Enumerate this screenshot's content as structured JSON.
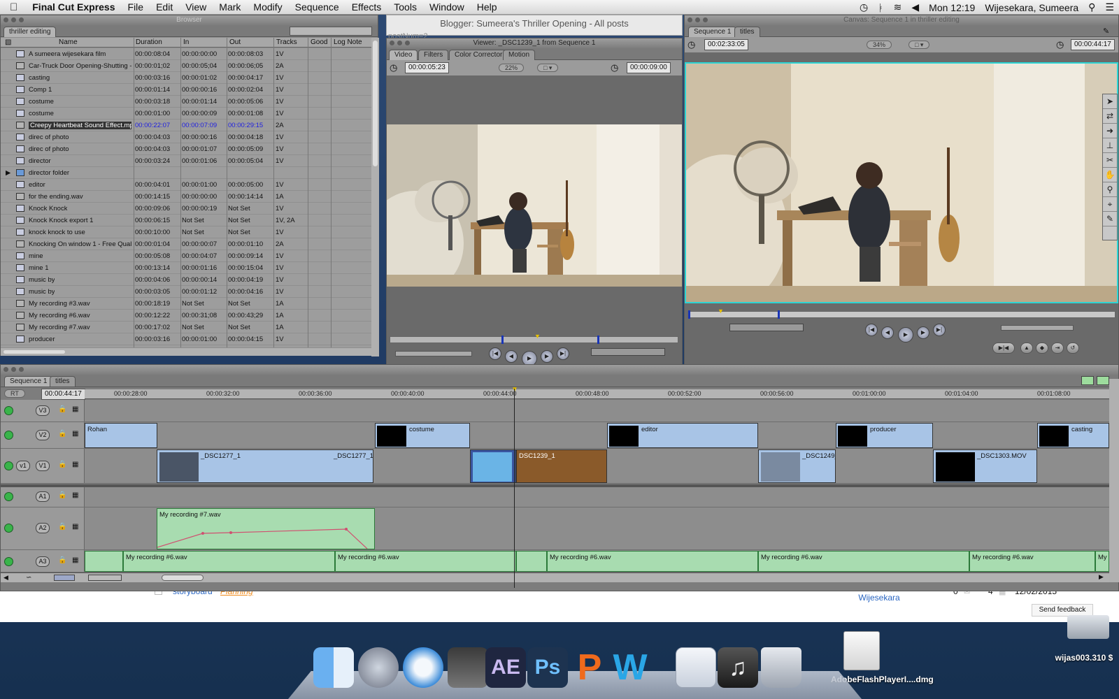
{
  "menubar": {
    "app_name": "Final Cut Express",
    "items": [
      "File",
      "Edit",
      "View",
      "Mark",
      "Modify",
      "Sequence",
      "Effects",
      "Tools",
      "Window",
      "Help"
    ],
    "clock": "Mon 12:19",
    "user": "Wijesekara, Sumeera"
  },
  "blogger_window": {
    "title": "Blogger: Sumeera's Thriller Opening - All posts",
    "url_fragment": "postNum=2"
  },
  "browser": {
    "title": "Browser",
    "tab": "thriller editing",
    "columns": [
      "Name",
      "Duration",
      "In",
      "Out",
      "Tracks",
      "Good",
      "Log Note"
    ],
    "rows": [
      {
        "name": "A sumeera wijesekara film",
        "duration": "00:00:08:04",
        "in": "00:00:00:00",
        "out": "00:00:08:03",
        "tracks": "1V",
        "kind": "seq"
      },
      {
        "name": "Car-Truck Door Opening-Shutting -",
        "duration": "00:00:01;02",
        "in": "00:00:05;04",
        "out": "00:00:06;05",
        "tracks": "2A",
        "kind": "audio"
      },
      {
        "name": "casting",
        "duration": "00:00:03:16",
        "in": "00:00:01:02",
        "out": "00:00:04:17",
        "tracks": "1V",
        "kind": "seq"
      },
      {
        "name": "Comp 1",
        "duration": "00:00:01:14",
        "in": "00:00:00:16",
        "out": "00:00:02:04",
        "tracks": "1V",
        "kind": "seq"
      },
      {
        "name": "costume",
        "duration": "00:00:03:18",
        "in": "00:00:01:14",
        "out": "00:00:05:06",
        "tracks": "1V",
        "kind": "seq"
      },
      {
        "name": "costume",
        "duration": "00:00:01:00",
        "in": "00:00:00:09",
        "out": "00:00:01:08",
        "tracks": "1V",
        "kind": "seq"
      },
      {
        "name": "Creepy Heartbeat Sound Effect.mp3",
        "duration": "00:00:22:07",
        "in": "00:00:07:09",
        "out": "00:00:29:15",
        "tracks": "2A",
        "kind": "audio",
        "selected": true
      },
      {
        "name": "direc of photo",
        "duration": "00:00:04:03",
        "in": "00:00:00:16",
        "out": "00:00:04:18",
        "tracks": "1V",
        "kind": "seq"
      },
      {
        "name": "direc of photo",
        "duration": "00:00:04:03",
        "in": "00:00:01:07",
        "out": "00:00:05:09",
        "tracks": "1V",
        "kind": "seq"
      },
      {
        "name": "director",
        "duration": "00:00:03:24",
        "in": "00:00:01:06",
        "out": "00:00:05:04",
        "tracks": "1V",
        "kind": "seq"
      },
      {
        "name": "director folder",
        "duration": "",
        "in": "",
        "out": "",
        "tracks": "",
        "kind": "folder"
      },
      {
        "name": "editor",
        "duration": "00:00:04:01",
        "in": "00:00:01:00",
        "out": "00:00:05:00",
        "tracks": "1V",
        "kind": "seq"
      },
      {
        "name": "for the ending.wav",
        "duration": "00:00:14:15",
        "in": "00:00:00:00",
        "out": "00:00:14:14",
        "tracks": "1A",
        "kind": "audio"
      },
      {
        "name": "Knock Knock",
        "duration": "00:00:09:06",
        "in": "00:00:00:19",
        "out": "Not Set",
        "tracks": "1V",
        "kind": "seq"
      },
      {
        "name": "Knock Knock export 1",
        "duration": "00:00:06:15",
        "in": "Not Set",
        "out": "Not Set",
        "tracks": "1V, 2A",
        "kind": "seq"
      },
      {
        "name": "knock knock to use",
        "duration": "00:00:10:00",
        "in": "Not Set",
        "out": "Not Set",
        "tracks": "1V",
        "kind": "seq"
      },
      {
        "name": "Knocking On window 1 - Free Quali",
        "duration": "00:00:01:04",
        "in": "00:00:00:07",
        "out": "00:00:01:10",
        "tracks": "2A",
        "kind": "audio"
      },
      {
        "name": "mine",
        "duration": "00:00:05:08",
        "in": "00:00:04:07",
        "out": "00:00:09:14",
        "tracks": "1V",
        "kind": "seq"
      },
      {
        "name": "mine 1",
        "duration": "00:00:13:14",
        "in": "00:00:01:16",
        "out": "00:00:15:04",
        "tracks": "1V",
        "kind": "seq"
      },
      {
        "name": "music by",
        "duration": "00:00:04:06",
        "in": "00:00:00:14",
        "out": "00:00:04:19",
        "tracks": "1V",
        "kind": "seq"
      },
      {
        "name": "music by",
        "duration": "00:00:03:05",
        "in": "00:00:01:12",
        "out": "00:00:04:16",
        "tracks": "1V",
        "kind": "seq"
      },
      {
        "name": "My recording #3.wav",
        "duration": "00:00:18:19",
        "in": "Not Set",
        "out": "Not Set",
        "tracks": "1A",
        "kind": "audio"
      },
      {
        "name": "My recording #6.wav",
        "duration": "00:00:12:22",
        "in": "00:00:31;08",
        "out": "00:00:43;29",
        "tracks": "1A",
        "kind": "audio"
      },
      {
        "name": "My recording #7.wav",
        "duration": "00:00:17:02",
        "in": "Not Set",
        "out": "Not Set",
        "tracks": "1A",
        "kind": "audio"
      },
      {
        "name": "producer",
        "duration": "00:00:03:16",
        "in": "00:00:01:00",
        "out": "00:00:04:15",
        "tracks": "1V",
        "kind": "seq"
      }
    ]
  },
  "viewer": {
    "title": "Viewer: _DSC1239_1 from Sequence 1",
    "tabs": [
      "Video",
      "Filters",
      "Color Corrector",
      "Motion"
    ],
    "timecode_duration": "00:00:05:23",
    "zoom": "22%",
    "timecode_current": "00:00:09:00"
  },
  "canvas": {
    "title": "Canvas: Sequence 1 in thriller editing",
    "tabs": [
      "Sequence 1",
      "titles"
    ],
    "timecode_duration": "00:02:33:05",
    "zoom": "34%",
    "timecode_current": "00:00:44:17"
  },
  "timeline": {
    "tabs": [
      "Sequence 1",
      "titles"
    ],
    "rt_label": "RT",
    "timecode": "00:00:44:17",
    "ruler": [
      "00:00:28:00",
      "00:00:32:00",
      "00:00:36:00",
      "00:00:40:00",
      "00:00:44:00",
      "00:00:48:00",
      "00:00:52:00",
      "00:00:56:00",
      "00:01:00:00",
      "00:01:04:00",
      "00:01:08:00"
    ],
    "track_labels": {
      "v3": "V3",
      "v2": "V2",
      "v1": "V1",
      "v1src": "v1",
      "a1": "A1",
      "a2": "A2",
      "a3": "A3"
    },
    "v2_clips": [
      "Rohan",
      "costume",
      "editor",
      "producer",
      "casting"
    ],
    "v1_clips": [
      "_DSC1277_1",
      "_DSC1277_1",
      "DSC1239_1",
      "_DSC1249_",
      "_DSC1303.MOV"
    ],
    "a2_clip": "My recording #7.wav",
    "a3_clips": [
      "My recording #6.wav",
      "My recording #6.wav",
      "My recording #6.wav",
      "My recording #6.wav",
      "My recording #6.wav",
      "My r"
    ]
  },
  "blog_row": {
    "link1": "storyboard",
    "link2": "Planning",
    "author": "Sumeera Wijesekara",
    "comments": "0",
    "views": "4",
    "date": "12/02/2015",
    "feedback": "Send feedback"
  },
  "desktop": {
    "file1": "AdobeFlashPlayerI....dmg",
    "drive": "wijas003.310 $"
  },
  "dock": {
    "icons": [
      "finder-icon",
      "launchpad-icon",
      "safari-icon",
      "final-cut-express-icon",
      "after-effects-icon",
      "photoshop-icon",
      "powerpoint-icon",
      "word-icon",
      "document-icon",
      "itunes-icon",
      "trash-icon"
    ],
    "ae_text": "AE",
    "ps_text": "Ps"
  },
  "colors": {
    "video_clip": "#a8c4e6",
    "audio_clip": "#a8dcb0",
    "selected_clip": "#8a5a2a",
    "canvas_border": "#2dd4d4"
  }
}
